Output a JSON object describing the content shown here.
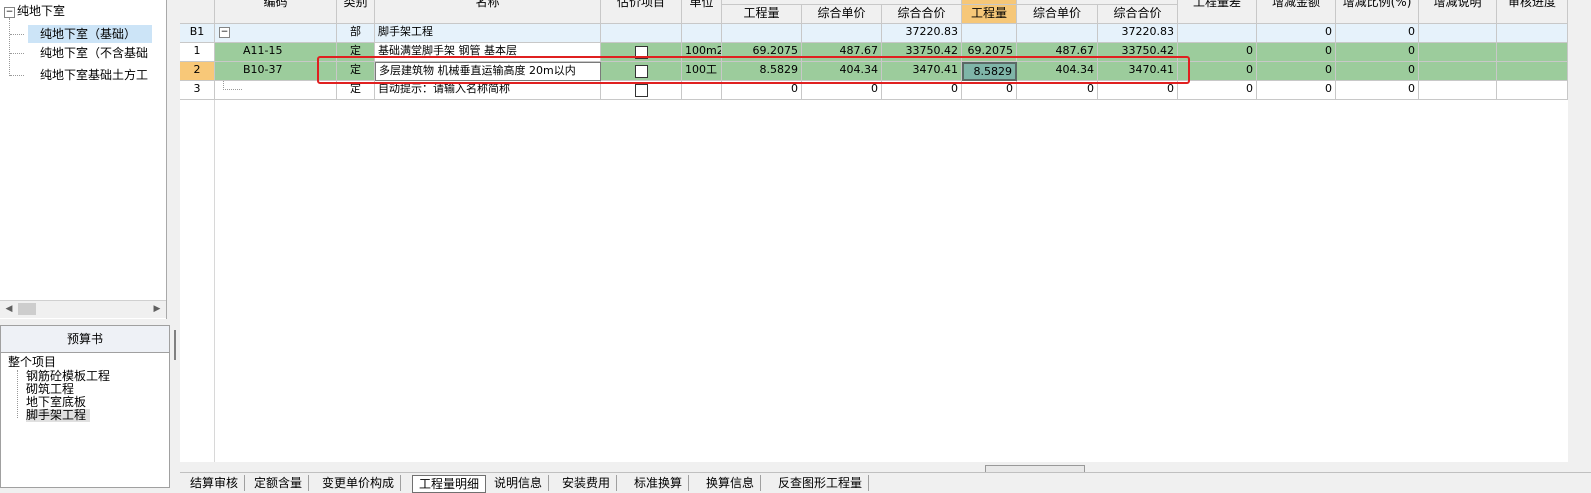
{
  "tree": {
    "root_label": "纯地下室",
    "items": [
      {
        "label": "纯地下室（基础）",
        "selected": true
      },
      {
        "label": "纯地下室（不含基础",
        "selected": false
      },
      {
        "label": "纯地下室基础土方工",
        "selected": false
      }
    ]
  },
  "budget": {
    "title": "预算书",
    "root": "整个项目",
    "items": [
      "钢筋砼模板工程",
      "砌筑工程",
      "地下室底板",
      "脚手架工程"
    ]
  },
  "grid": {
    "headers": {
      "code": "编码",
      "type": "类别",
      "name": "名称",
      "estimate": "估价项目",
      "unit": "单位",
      "qty1": "工程量",
      "uprice1": "综合单价",
      "total1": "综合合价",
      "qty2": "工程量",
      "uprice2": "综合单价",
      "total2": "综合合价",
      "qtydiff": "工程量差",
      "amtchange": "增减金额",
      "ratio": "增减比例(%)",
      "desc": "增减说明",
      "audit": "审核进度"
    },
    "rows": [
      {
        "num": "B1",
        "code": "",
        "type": "部",
        "name": "脚手架工程",
        "unit": "",
        "qty1": "",
        "uprice1": "",
        "total1": "37220.83",
        "qty2": "",
        "uprice2": "",
        "total2": "37220.83",
        "qtydiff": "",
        "amtchange": "0",
        "ratio": "0"
      },
      {
        "num": "1",
        "code": "A11-15",
        "type": "定",
        "name": "基础满堂脚手架 钢管 基本层",
        "unit": "100m2",
        "qty1": "69.2075",
        "uprice1": "487.67",
        "total1": "33750.42",
        "qty2": "69.2075",
        "uprice2": "487.67",
        "total2": "33750.42",
        "qtydiff": "0",
        "amtchange": "0",
        "ratio": "0"
      },
      {
        "num": "2",
        "code": "B10-37",
        "type": "定",
        "name": "多层建筑物 机械垂直运输高度 20m以内",
        "unit": "100工",
        "qty1": "8.5829",
        "uprice1": "404.34",
        "total1": "3470.41",
        "qty2": "8.5829",
        "uprice2": "404.34",
        "total2": "3470.41",
        "qtydiff": "0",
        "amtchange": "0",
        "ratio": "0"
      },
      {
        "num": "3",
        "code": "",
        "type": "定",
        "name": "自动提示：请输入名称简称",
        "unit": "",
        "qty1": "0",
        "uprice1": "0",
        "total1": "0",
        "qty2": "0",
        "uprice2": "0",
        "total2": "0",
        "qtydiff": "0",
        "amtchange": "0",
        "ratio": "0"
      }
    ]
  },
  "tabs": [
    "结算审核",
    "定额含量",
    "变更单价构成",
    "工程量明细",
    "说明信息",
    "安装费用",
    "标准换算",
    "换算信息",
    "反查图形工程量"
  ],
  "colors": {
    "highlight_header": "#f6c778",
    "row_green": "#9ccc9c",
    "annotation_red": "#e02020"
  }
}
